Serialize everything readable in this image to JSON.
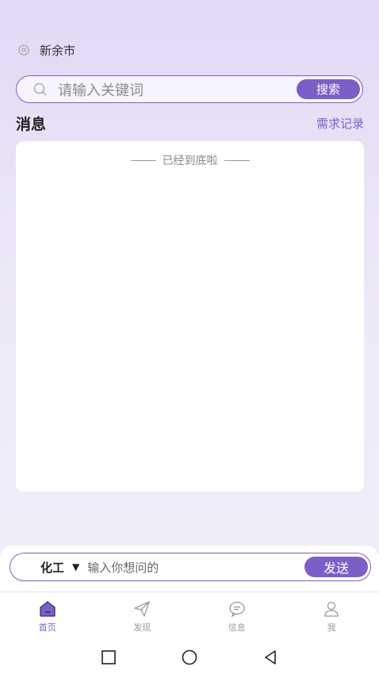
{
  "location": {
    "city": "新余市"
  },
  "search": {
    "placeholder": "请输入关键词",
    "button_label": "搜索"
  },
  "messages": {
    "title": "消息",
    "link_label": "需求记录",
    "end_note": "已经到底啦"
  },
  "ask": {
    "category": "化工",
    "placeholder": "输入你想问的",
    "send_label": "发送"
  },
  "tabs": [
    {
      "label": "首页",
      "icon": "home-icon",
      "active": true
    },
    {
      "label": "发现",
      "icon": "paper-plane-icon",
      "active": false
    },
    {
      "label": "信息",
      "icon": "chat-bubble-icon",
      "active": false
    },
    {
      "label": "我",
      "icon": "user-icon",
      "active": false
    }
  ],
  "colors": {
    "accent": "#7b5fc6",
    "background_top": "#e2d9f5",
    "inactive": "#999999"
  }
}
